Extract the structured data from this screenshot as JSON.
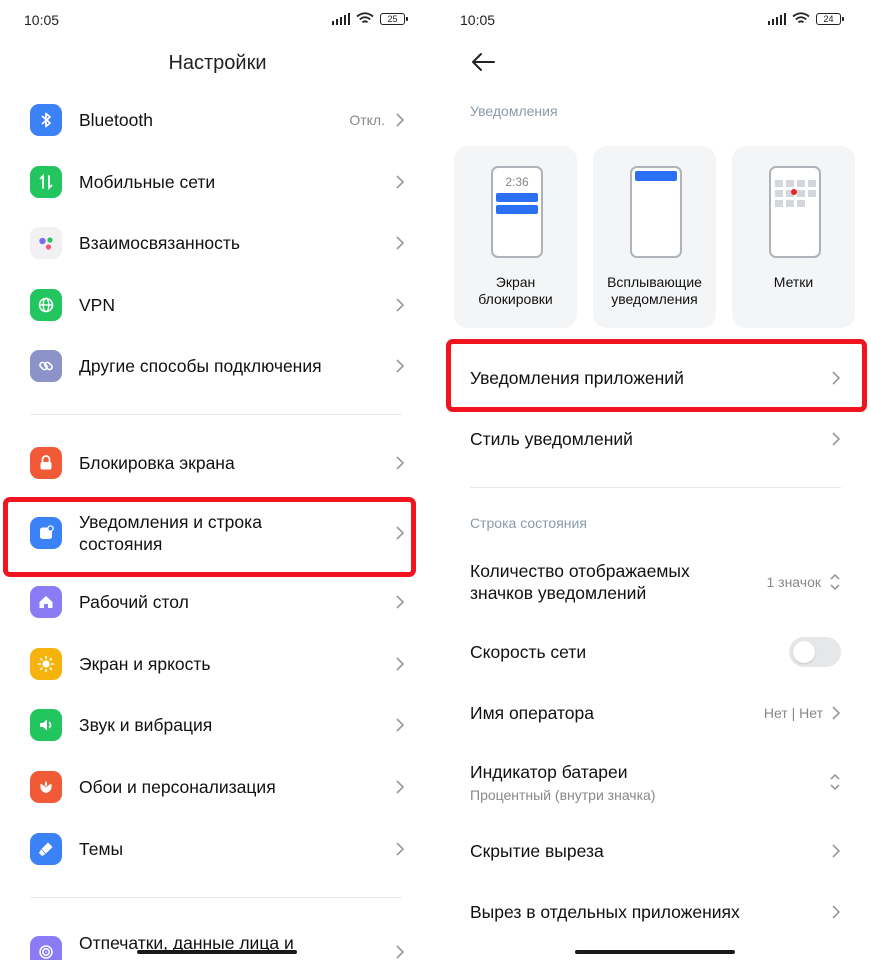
{
  "left": {
    "status": {
      "time": "10:05",
      "battery": "25"
    },
    "title": "Настройки",
    "items": [
      {
        "label": "Bluetooth",
        "value": "Откл.",
        "icon": "bluetooth-icon",
        "color": "#3b82f6"
      },
      {
        "label": "Мобильные сети",
        "icon": "mobile-data-icon",
        "color": "#22c55e"
      },
      {
        "label": "Взаимосвязанность",
        "icon": "interconnect-icon",
        "color": "#f1f1f4"
      },
      {
        "label": "VPN",
        "icon": "globe-icon",
        "color": "#22c55e"
      },
      {
        "label": "Другие способы подключения",
        "icon": "link-icon",
        "color": "#8b93c9"
      },
      {
        "label": "Блокировка экрана",
        "icon": "lock-icon",
        "color": "#f05a37"
      },
      {
        "label_line1": "Уведомления и строка",
        "label_line2": "состояния",
        "icon": "notification-icon",
        "color": "#3b82f6"
      },
      {
        "label": "Рабочий стол",
        "icon": "home-icon",
        "color": "#8b7cf6"
      },
      {
        "label": "Экран и яркость",
        "icon": "sun-icon",
        "color": "#f5b30b"
      },
      {
        "label": "Звук и вибрация",
        "icon": "speaker-icon",
        "color": "#22c55e"
      },
      {
        "label": "Обои и персонализация",
        "icon": "flower-icon",
        "color": "#f05a37"
      },
      {
        "label": "Темы",
        "icon": "brush-icon",
        "color": "#3b82f6"
      },
      {
        "label": "Отпечатки, данные лица и",
        "icon": "fingerprint-icon",
        "color": "#8b7cf6"
      }
    ]
  },
  "right": {
    "status": {
      "time": "10:05",
      "battery": "24"
    },
    "section_notifications": "Уведомления",
    "cards": [
      {
        "line1": "Экран",
        "line2": "блокировки",
        "clock": "2:36"
      },
      {
        "line1": "Всплывающие",
        "line2": "уведомления"
      },
      {
        "line1": "Метки",
        "line2": ""
      }
    ],
    "app_notifications": "Уведомления приложений",
    "notification_style": "Стиль уведомлений",
    "section_statusbar": "Строка состояния",
    "icon_count_line1": "Количество отображаемых",
    "icon_count_line2": "значков уведомлений",
    "icon_count_value": "1 значок",
    "network_speed": "Скорость сети",
    "operator_name": "Имя оператора",
    "operator_value": "Нет | Нет",
    "battery_indicator": "Индикатор батареи",
    "battery_indicator_sub": "Процентный (внутри значка)",
    "notch_hide": "Скрытие выреза",
    "notch_apps": "Вырез в отдельных приложениях"
  },
  "colors": {
    "highlight": "#f0141e",
    "accent": "#3b82f6"
  }
}
